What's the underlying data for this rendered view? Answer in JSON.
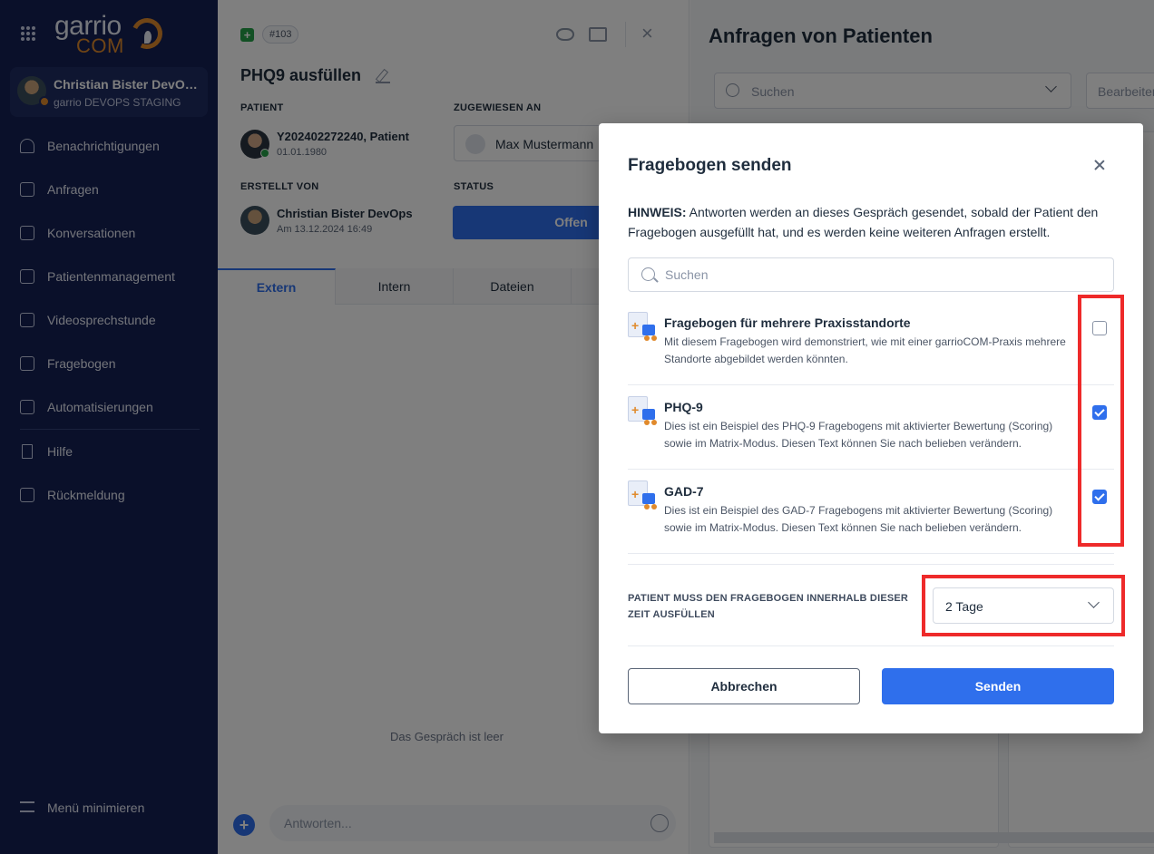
{
  "sidebar": {
    "logo_main": "garrio",
    "logo_sub": "COM",
    "user": {
      "name": "Christian Bister DevOps",
      "org": "garrio DEVOPS STAGING"
    },
    "items": [
      {
        "label": "Benachrichtigungen",
        "icon": "bell-icon"
      },
      {
        "label": "Anfragen",
        "icon": "inbox-icon"
      },
      {
        "label": "Konversationen",
        "icon": "chat-icon"
      },
      {
        "label": "Patientenmanagement",
        "icon": "patient-icon"
      },
      {
        "label": "Videosprechstunde",
        "icon": "calendar-icon"
      },
      {
        "label": "Fragebogen",
        "icon": "clipboard-icon"
      },
      {
        "label": "Automatisierungen",
        "icon": "robot-icon"
      },
      {
        "label": "Hilfe",
        "icon": "bookmark-icon"
      },
      {
        "label": "Rückmeldung",
        "icon": "feedback-icon"
      }
    ],
    "minimize_label": "Menü minimieren"
  },
  "ticket": {
    "add_symbol": "+",
    "number": "#103",
    "title": "PHQ9 ausfüllen",
    "patient_label": "PATIENT",
    "patient_name": "Y202402272240, Patient",
    "patient_dob": "01.01.1980",
    "assigned_label": "ZUGEWIESEN AN",
    "assigned_name": "Max Mustermann",
    "created_label": "ERSTELLT VON",
    "creator_name": "Christian Bister DevOps",
    "created_at": "Am 13.12.2024 16:49",
    "status_label": "STATUS",
    "status_value": "Offen",
    "tabs": [
      "Extern",
      "Intern",
      "Dateien"
    ],
    "empty_message": "Das Gespräch ist leer",
    "reply_placeholder": "Antworten...",
    "reply_plus": "+"
  },
  "right": {
    "title": "Anfragen von Patienten",
    "search_placeholder": "Suchen",
    "filter_placeholder": "Bearbeiter"
  },
  "modal": {
    "title": "Fragebogen senden",
    "hint_label": "HINWEIS:",
    "hint_text": " Antworten werden an dieses Gespräch gesendet, sobald der Patient den Fragebogen ausgefüllt hat, und es werden keine weiteren Anfragen erstellt.",
    "search_placeholder": "Suchen",
    "questionnaires": [
      {
        "title": "Fragebogen für mehrere Praxisstandorte",
        "description": "Mit diesem Fragebogen wird demonstriert, wie mit einer garrioCOM-Praxis mehrere Standorte abgebildet werden könnten.",
        "checked": false
      },
      {
        "title": "PHQ-9",
        "description": "Dies ist ein Beispiel des PHQ-9 Fragebogens mit aktivierter Bewertung (Scoring) sowie im Matrix-Modus. Diesen Text können Sie nach belieben verändern.",
        "checked": true
      },
      {
        "title": "GAD-7",
        "description": "Dies ist ein Beispiel des GAD-7 Fragebogens mit aktivierter Bewertung (Scoring) sowie im Matrix-Modus. Diesen Text können Sie nach belieben verändern.",
        "checked": true
      }
    ],
    "due_label": "PATIENT MUSS DEN FRAGEBOGEN INNERHALB DIESER ZEIT AUSFÜLLEN",
    "due_value": "2 Tage",
    "cancel_label": "Abbrechen",
    "send_label": "Senden"
  },
  "colors": {
    "sidebar_bg": "#152154",
    "primary": "#2f6fec",
    "accent_orange": "#e08a2c",
    "highlight_red": "#ee2a2a",
    "success_green": "#24a148"
  }
}
